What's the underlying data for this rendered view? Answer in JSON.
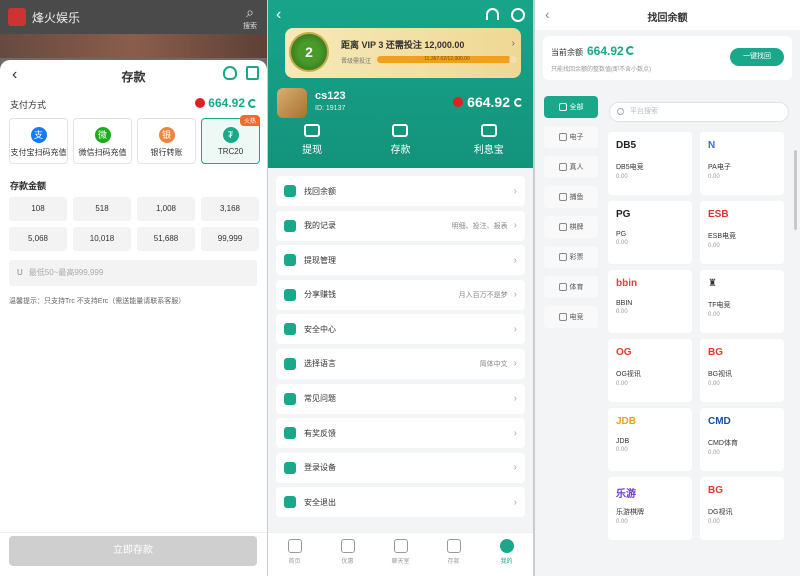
{
  "deposit": {
    "brand": "烽火娱乐",
    "search_label": "搜索",
    "title": "存款",
    "back": "‹",
    "pay_label": "支付方式",
    "balance": "664.92",
    "methods": [
      {
        "label": "支付宝扫码充值",
        "icon": "支",
        "color": "#1677ff"
      },
      {
        "label": "微信扫码充值",
        "icon": "微",
        "color": "#1aad19"
      },
      {
        "label": "银行转账",
        "icon": "银",
        "color": "#f0843c"
      },
      {
        "label": "TRC20",
        "icon": "₮",
        "color": "#1aa88a",
        "tag": "火热"
      }
    ],
    "amount_label": "存款金额",
    "amounts": [
      "108",
      "518",
      "1,008",
      "3,168",
      "5,068",
      "10,018",
      "51,688",
      "99,999"
    ],
    "input_prefix": "U",
    "input_placeholder": "最低50~最高999,999",
    "tip": "温馨提示：只支持Trc 不支持Erc（需送能量请联系客服）",
    "submit": "立即存款"
  },
  "profile": {
    "vip_text": "距离 VIP 3 还需投注 12,000.00",
    "vip_level": "2",
    "vip_sub": "晋级需投注",
    "vip_progress_text": "11,367.02/12,000.00",
    "vip_progress": 0.947,
    "username": "cs123",
    "uid": "ID: 19137",
    "balance": "664.92",
    "quick": [
      "提现",
      "存款",
      "利息宝"
    ],
    "menu": [
      {
        "label": "找回余额",
        "value": ""
      },
      {
        "label": "我的记录",
        "value": "明细、投注、报表"
      },
      {
        "label": "提现管理",
        "value": ""
      },
      {
        "label": "分享赚钱",
        "value": "月入百万不是梦"
      },
      {
        "label": "安全中心",
        "value": ""
      },
      {
        "label": "选择语言",
        "value": "简体中文"
      },
      {
        "label": "常见问题",
        "value": ""
      },
      {
        "label": "有奖反馈",
        "value": ""
      },
      {
        "label": "登录设备",
        "value": ""
      },
      {
        "label": "安全退出",
        "value": ""
      }
    ],
    "tabs": [
      "首页",
      "优惠",
      "聊天室",
      "存款",
      "我的"
    ]
  },
  "recover": {
    "title": "找回余额",
    "current_label": "当前余额",
    "balance": "664.92",
    "note": "只能找回余额的整数值(即不含小数点)",
    "button": "一键找回",
    "search_placeholder": "平台搜索",
    "categories": [
      "全部",
      "电子",
      "真人",
      "捕鱼",
      "棋牌",
      "彩票",
      "体育",
      "电竞"
    ],
    "games": [
      {
        "logo": "DB5",
        "name": "DB5电竞",
        "value": "0.00",
        "color": "#222"
      },
      {
        "logo": "N",
        "name": "PA电子",
        "value": "0.00",
        "color": "#3a6ae0"
      },
      {
        "logo": "PG",
        "name": "PG",
        "value": "0.00",
        "color": "#222"
      },
      {
        "logo": "ESB",
        "name": "ESB电竞",
        "value": "0.00",
        "color": "#e03030"
      },
      {
        "logo": "bbin",
        "name": "BBIN",
        "value": "0.00",
        "color": "#e04040"
      },
      {
        "logo": "♜",
        "name": "TF电竞",
        "value": "0.00",
        "color": "#333"
      },
      {
        "logo": "OG",
        "name": "OG视讯",
        "value": "0.00",
        "color": "#e03a2a"
      },
      {
        "logo": "BG",
        "name": "BG视讯",
        "value": "0.00",
        "color": "#e03a2a"
      },
      {
        "logo": "JDB",
        "name": "JDB",
        "value": "0.00",
        "color": "#e8a020"
      },
      {
        "logo": "CMD",
        "name": "CMD体育",
        "value": "0.00",
        "color": "#1a4ab0"
      },
      {
        "logo": "乐游",
        "name": "乐游棋牌",
        "value": "0.00",
        "color": "#6a3ad0"
      },
      {
        "logo": "BG",
        "name": "DG视讯",
        "value": "0.00",
        "color": "#e03a2a"
      }
    ]
  }
}
